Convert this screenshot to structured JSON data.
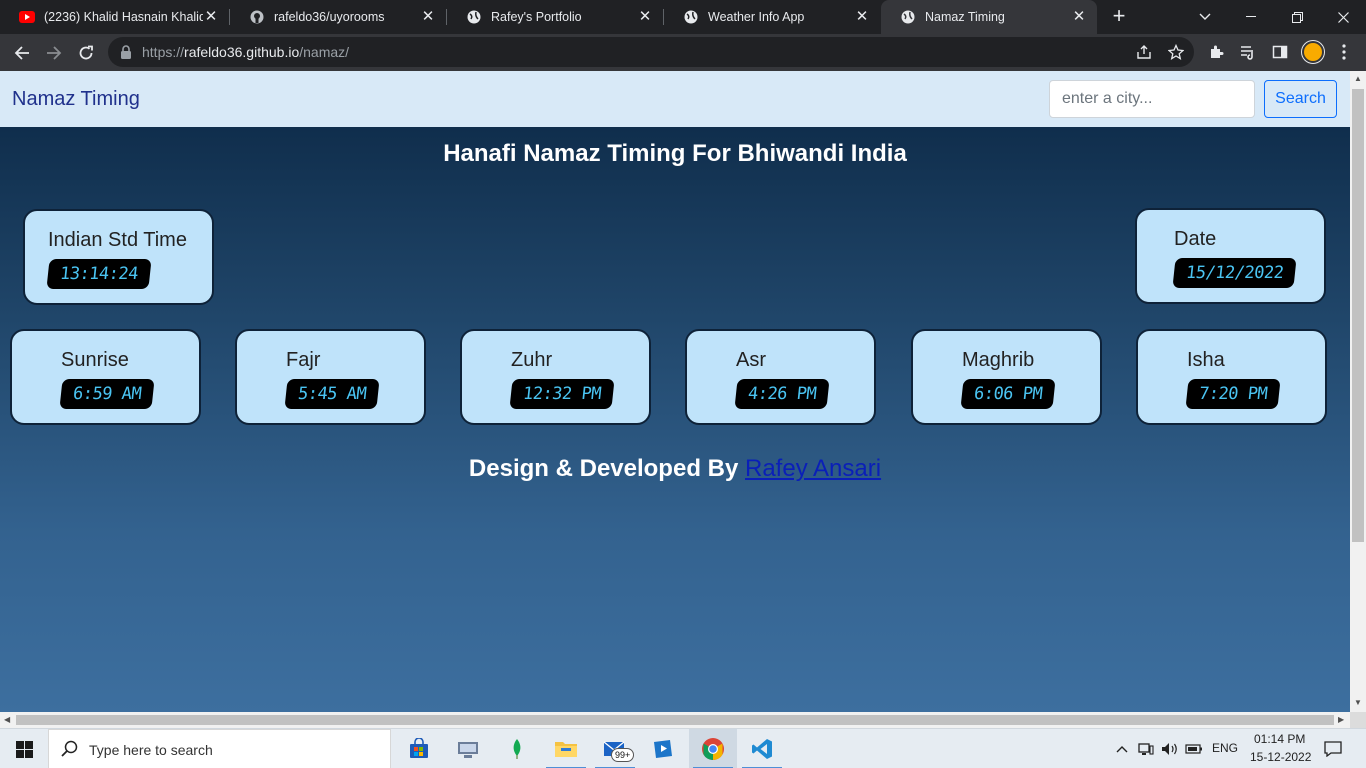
{
  "browser": {
    "tabs": [
      {
        "title": "(2236) Khalid Hasnain Khalid",
        "icon": "youtube-icon",
        "active": false
      },
      {
        "title": "rafeldo36/uyorooms",
        "icon": "github-icon",
        "active": false
      },
      {
        "title": "Rafey's Portfolio",
        "icon": "globe-icon",
        "active": false
      },
      {
        "title": "Weather Info App",
        "icon": "globe-icon",
        "active": false
      },
      {
        "title": "Namaz Timing",
        "icon": "globe-icon",
        "active": true
      }
    ],
    "url_scheme": "https://",
    "url_host": "rafeldo36.github.io",
    "url_path": "/namaz/"
  },
  "navbar": {
    "brand": "Namaz Timing",
    "search_placeholder": "enter a city...",
    "search_button": "Search"
  },
  "page": {
    "heading": "Hanafi Namaz Timing For Bhiwandi India",
    "clock": {
      "label": "Indian Std Time",
      "value": "13:14:24"
    },
    "date": {
      "label": "Date",
      "value": "15/12/2022"
    },
    "prayers": [
      {
        "name": "Sunrise",
        "time": "6:59 AM"
      },
      {
        "name": "Fajr",
        "time": "5:45 AM"
      },
      {
        "name": "Zuhr",
        "time": "12:32 PM"
      },
      {
        "name": "Asr",
        "time": "4:26 PM"
      },
      {
        "name": "Maghrib",
        "time": "6:06 PM"
      },
      {
        "name": "Isha",
        "time": "7:20 PM"
      }
    ],
    "footer_text": "Design & Developed By",
    "footer_link": "Rafey Ansari"
  },
  "taskbar": {
    "search_text": "Type here to search",
    "mail_badge": "99+",
    "language": "ENG",
    "time": "01:14 PM",
    "date": "15-12-2022"
  },
  "colors": {
    "card_bg": "#bfe3fa",
    "lcd_text": "#4ac4f2",
    "navbar_bg": "#d8e9f7",
    "accent": "#0d6efd"
  }
}
